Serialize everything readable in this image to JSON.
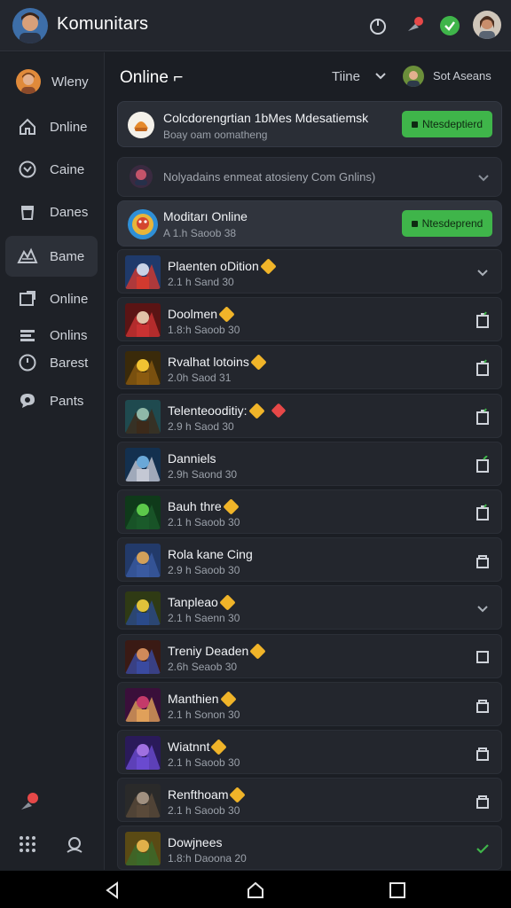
{
  "app": {
    "title": "Komunitars"
  },
  "topbar": {
    "icons": [
      "power-icon",
      "notification-icon",
      "check-badge-icon",
      "profile-avatar"
    ]
  },
  "sidebar": {
    "profile_label": "Wleny",
    "items": [
      {
        "label": "Dnline",
        "icon": "home-icon"
      },
      {
        "label": "Caine",
        "icon": "clock-icon"
      },
      {
        "label": "Danes",
        "icon": "trash-icon"
      },
      {
        "label": "Bame",
        "icon": "game-icon",
        "active": true
      },
      {
        "label": "Online",
        "icon": "window-icon"
      },
      {
        "label": "Onlins",
        "icon": "list-icon"
      },
      {
        "label": "Barest",
        "icon": "timer-icon"
      },
      {
        "label": "Pants",
        "icon": "chat-icon"
      }
    ]
  },
  "main": {
    "title": "Online ⌐",
    "filter_label": "Tiine",
    "sort_label": "Sot Aseans"
  },
  "cards": {
    "top": {
      "title": "Colcdorengrtian 1bMes Mdesatiemsk",
      "subtitle": "Boay oam oomatheng",
      "button": "Ntesdeptierd"
    },
    "collapsed": {
      "title": "Nolyadains enmeat atosieny Com Gnlins)"
    },
    "highlight": {
      "title": "Moditarı Online",
      "subtitle": "A 1.h Saoob 38",
      "button": "Ntesdeprend"
    }
  },
  "games": [
    {
      "name": "Plaenten oDition",
      "meta": "2.1 h Sand 30",
      "gem": true,
      "action": "chevron-down-icon"
    },
    {
      "name": "Doolmen",
      "meta": "1.8:h Saoob 30",
      "gem": true,
      "action": "battery-icon"
    },
    {
      "name": "Rvalhat lotoins",
      "meta": "2.0h Saod 31",
      "gem": true,
      "action": "battery-icon"
    },
    {
      "name": "Telenteooditiy:",
      "meta": "2.9 h Saod 30",
      "gem": true,
      "gem2": true,
      "action": "battery-icon"
    },
    {
      "name": "Danniels",
      "meta": "2.9h Saond 30",
      "gem": false,
      "action": "battery-check-icon"
    },
    {
      "name": "Bauh thre",
      "meta": "2.1 h Saoob 30",
      "gem": true,
      "action": "battery-icon"
    },
    {
      "name": "Rola kane Cing",
      "meta": "2.9 h Saoob 30",
      "gem": false,
      "action": "lock-icon"
    },
    {
      "name": "Tanpleao",
      "meta": "2.1 h Saenn 30",
      "gem": true,
      "action": "chevron-down-icon"
    },
    {
      "name": "Treniy Deaden",
      "meta": "2.6h Seaob 30",
      "gem": true,
      "action": "square-icon"
    },
    {
      "name": "Manthien",
      "meta": "2.1 h Sonon 30",
      "gem": true,
      "action": "lock-icon"
    },
    {
      "name": "Wiatnnt",
      "meta": "2.1 h Saoob 30",
      "gem": true,
      "action": "lock-icon"
    },
    {
      "name": "Renfthoam",
      "meta": "2.1 h Saoob 30",
      "gem": true,
      "action": "lock-icon"
    },
    {
      "name": "Dowjnees",
      "meta": "1.8:h Daoona 20",
      "gem": false,
      "action": "check-icon"
    }
  ],
  "colors": {
    "accent": "#3fb54a",
    "gem": "#f0b429",
    "background": "#1b1e24",
    "card": "#2a2e36"
  }
}
